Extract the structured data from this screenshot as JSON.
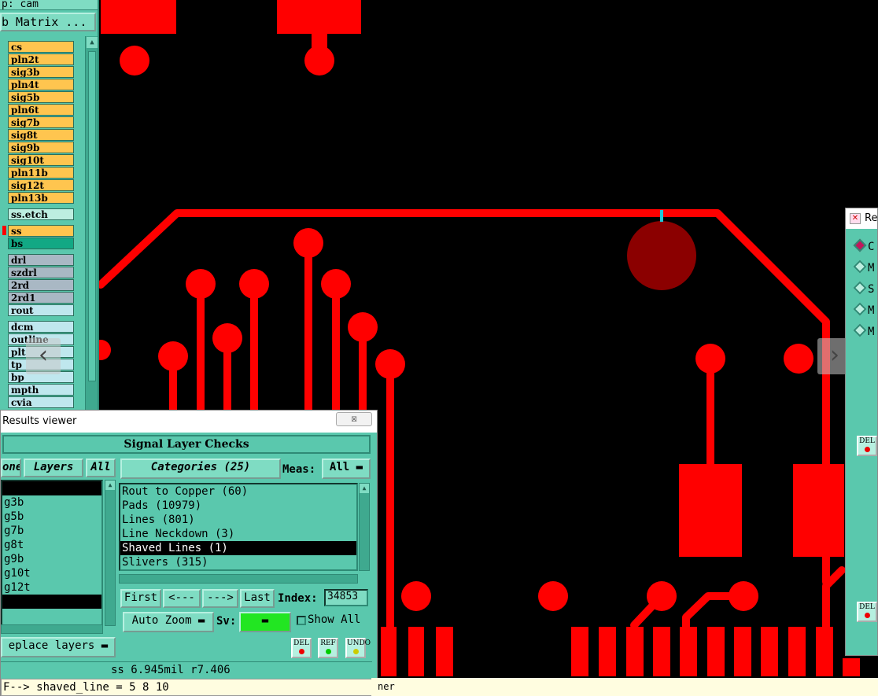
{
  "left_panel": {
    "title": "p: cam",
    "matrix_button": "b Matrix ...",
    "layers": [
      {
        "name": "cs",
        "color": "orange"
      },
      {
        "name": "pln2t",
        "color": "orange"
      },
      {
        "name": "sig3b",
        "color": "orange",
        "mark": "✎"
      },
      {
        "name": "pln4t",
        "color": "orange"
      },
      {
        "name": "sig5b",
        "color": "orange"
      },
      {
        "name": "pln6t",
        "color": "orange"
      },
      {
        "name": "sig7b",
        "color": "orange"
      },
      {
        "name": "sig8t",
        "color": "orange"
      },
      {
        "name": "sig9b",
        "color": "orange"
      },
      {
        "name": "sig10t",
        "color": "orange"
      },
      {
        "name": "pln11b",
        "color": "orange"
      },
      {
        "name": "sig12t",
        "color": "orange"
      },
      {
        "name": "pln13b",
        "color": "orange"
      },
      {
        "name": "ss.etch",
        "color": "teal"
      },
      {
        "name": "ss",
        "color": "orange",
        "mark": "m"
      },
      {
        "name": "bs",
        "color": "green"
      },
      {
        "name": "drl",
        "color": "gray"
      },
      {
        "name": "szdrl",
        "color": "gray"
      },
      {
        "name": "2rd",
        "color": "gray"
      },
      {
        "name": "2rd1",
        "color": "gray"
      },
      {
        "name": "rout",
        "color": "light"
      },
      {
        "name": "dcm",
        "color": "light"
      },
      {
        "name": "outline",
        "color": "light"
      },
      {
        "name": "plt",
        "color": "light"
      },
      {
        "name": "tp",
        "color": "light"
      },
      {
        "name": "bp",
        "color": "light"
      },
      {
        "name": "mpth",
        "color": "light"
      },
      {
        "name": "cvia",
        "color": "light"
      }
    ]
  },
  "results_viewer": {
    "window_title": "Results viewer",
    "close_glyph": "☒",
    "header": "Signal Layer Checks",
    "none_button": "one",
    "layers_button": "Layers",
    "all_button": "All",
    "categories_button": "Categories (25)",
    "meas_label": "Meas:",
    "meas_value": "All",
    "layer_list": [
      "",
      "g3b",
      "g5b",
      "g7b",
      "g8t",
      "g9b",
      "g10t",
      "g12t",
      ""
    ],
    "categories": [
      {
        "label": "Rout to Copper (60)",
        "selected": false
      },
      {
        "label": "Pads (10979)",
        "selected": false
      },
      {
        "label": "Lines (801)",
        "selected": false
      },
      {
        "label": "Line Neckdown (3)",
        "selected": false
      },
      {
        "label": "Shaved Lines (1)",
        "selected": true
      },
      {
        "label": "Slivers (315)",
        "selected": false
      }
    ],
    "nav": {
      "first": "First",
      "prev": "<---",
      "next": "--->",
      "last": "Last",
      "index_label": "Index:",
      "index_value": "34853"
    },
    "auto_zoom": "Auto Zoom",
    "sv_label": "Sv:",
    "show_all": "Show All",
    "replace_layers": "eplace layers",
    "icon_del": "DEL",
    "icon_ref": "REF",
    "icon_undo": "UNDO",
    "status": "ss 6.945mil  r7.406",
    "command": "F--> shaved_line = 5 8 10"
  },
  "bottom_strip": "ner",
  "right_dialog": {
    "title": "Re",
    "radios": [
      {
        "label": "C",
        "on": true
      },
      {
        "label": "M",
        "on": false
      },
      {
        "label": "S",
        "on": false
      },
      {
        "label": "M",
        "on": false
      },
      {
        "label": "M",
        "on": false
      }
    ],
    "del_label": "DEL"
  },
  "colors": {
    "copper": "#ff0000",
    "highlight_pad": "#8b0000",
    "marker": "#20c8d8",
    "panel": "#5ac8ad"
  },
  "icons": {
    "prev": "‹",
    "next": "›"
  }
}
